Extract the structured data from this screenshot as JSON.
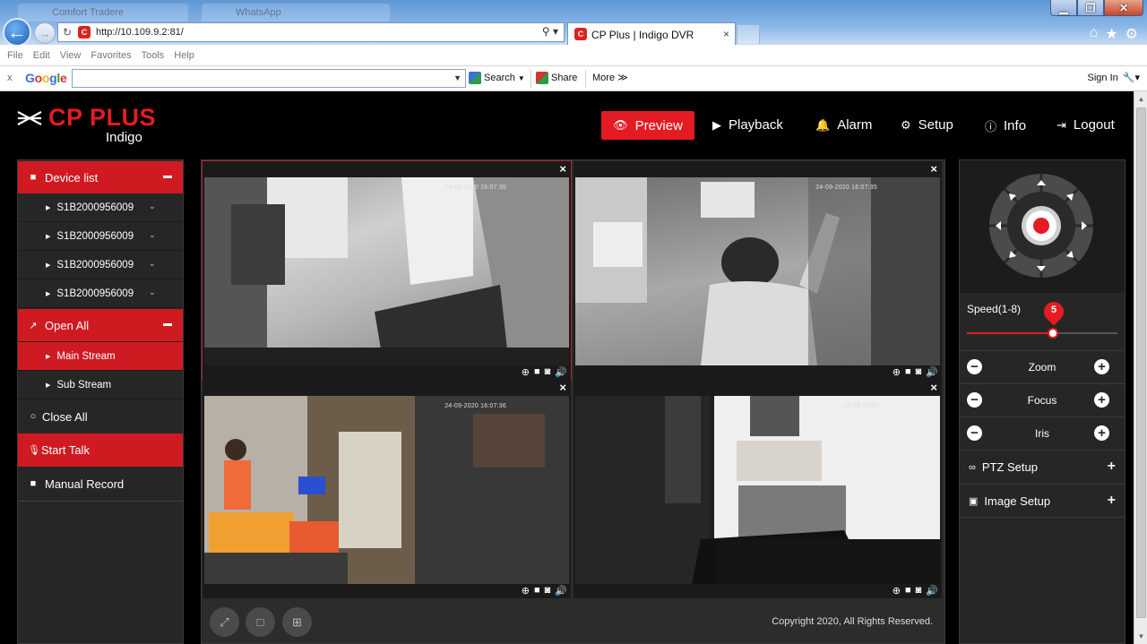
{
  "browser": {
    "ghost_tabs": [
      "Comfort Tradere",
      "WhatsApp"
    ],
    "url": "http://10.109.9.2:81/",
    "tab_title": "CP Plus | Indigo DVR",
    "tab_close": "×",
    "menu": [
      "File",
      "Edit",
      "View",
      "Favorites",
      "Tools",
      "Help"
    ],
    "toolbar": {
      "close": "x",
      "google": [
        "G",
        "o",
        "o",
        "g",
        "l",
        "e"
      ],
      "search_label": "Search",
      "share_label": "Share",
      "more_label": "More ≫",
      "signin_label": "Sign In"
    }
  },
  "app": {
    "brand": "CP PLUS",
    "brand_sub": "Indigo",
    "nav": {
      "preview": "Preview",
      "playback": "Playback",
      "alarm": "Alarm",
      "setup": "Setup",
      "info": "Info",
      "logout": "Logout"
    },
    "sidebar": {
      "device_list": "Device list",
      "devices": [
        "S1B2000956009",
        "S1B2000956009",
        "S1B2000956009",
        "S1B2000956009"
      ],
      "open_all": "Open All",
      "main_stream": "Main Stream",
      "sub_stream": "Sub Stream",
      "close_all": "Close All",
      "start_talk": "Start Talk",
      "manual_record": "Manual Record"
    },
    "video": {
      "timestamps": [
        "24-09-2020 16:07:35",
        "24-09-2020 16:07:35",
        "24-09-2020 16:07:36",
        "24-09-2020"
      ],
      "pane_close": "×",
      "copyright": "Copyright 2020, All Rights Reserved."
    },
    "ptz": {
      "speed_label": "Speed(1-8)",
      "speed_value": "5",
      "speed_min": 1,
      "speed_max": 8,
      "zoom": "Zoom",
      "focus": "Focus",
      "iris": "Iris",
      "ptz_setup": "PTZ Setup",
      "image_setup": "Image Setup"
    },
    "colors": {
      "brand_red": "#e41b23",
      "sidebar_active": "#d01a22",
      "panel_bg": "#262626"
    }
  }
}
